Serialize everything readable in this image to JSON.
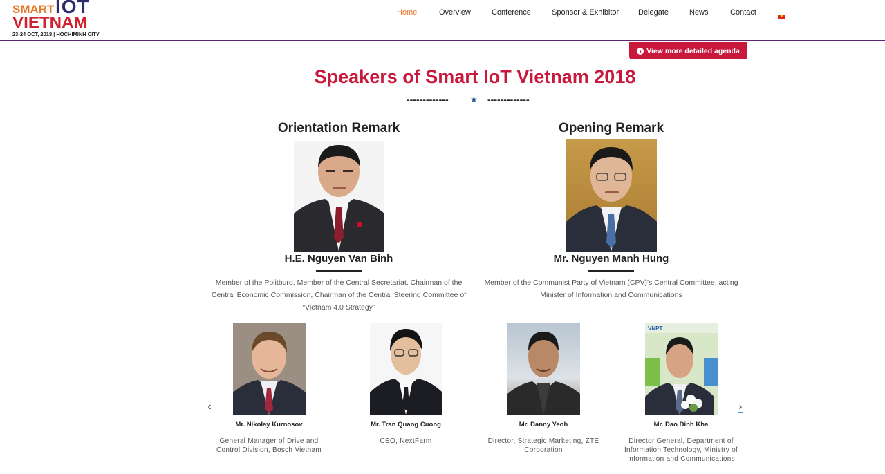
{
  "logo": {
    "smart": "SMART",
    "iot": "IOT",
    "vietnam": "VIETNAM",
    "dates": "23-24 OCT, 2018 | HOCHIMINH CITY"
  },
  "nav": {
    "items": [
      {
        "label": "Home",
        "active": true
      },
      {
        "label": "Overview"
      },
      {
        "label": "Conference"
      },
      {
        "label": "Sponsor & Exhibitor"
      },
      {
        "label": "Delegate"
      },
      {
        "label": "News"
      },
      {
        "label": "Contact"
      }
    ],
    "flag_icon": "vietnam-flag-icon"
  },
  "agenda_button": {
    "label": "View more detailed agenda",
    "icon": "circle-arrow-right-icon"
  },
  "page_title": "Speakers of Smart IoT Vietnam 2018",
  "divider": {
    "left": "-------------",
    "right": "-------------"
  },
  "featured": [
    {
      "section": "Orientation Remark",
      "name": "H.E. Nguyen Van Binh",
      "desc": "Member of the Politburo, Member of the Central Secretariat, Chairman of the Central Economic Commission, Chairman of the Central Steering Committee of “Vietnam 4.0 Strategy”"
    },
    {
      "section": "Opening Remark",
      "name": "Mr. Nguyen Manh Hung",
      "desc": "Member of the Communist Party of Vietnam (CPV)'s Central Committee, acting Minister of Information and Communications"
    }
  ],
  "speakers": [
    {
      "name": "Mr. Nikolay Kurnosov",
      "role": "General Manager of Drive and Control Division, Bosch Vietnam"
    },
    {
      "name": "Mr. Tran Quang Cuong",
      "role": "CEO, NextFarm"
    },
    {
      "name": "Mr. Danny Yeoh",
      "role": "Director, Strategic Marketing, ZTE Corporation"
    },
    {
      "name": "Mr. Dao Dinh Kha",
      "role": "Director General, Department of Information Technology, Ministry of Information and Communications"
    }
  ],
  "photo_backdrop": {
    "sign_text": "VNPT"
  },
  "carousel": {
    "prev": "‹",
    "next": "›"
  },
  "colors": {
    "accent": "#c8193c",
    "nav_active": "#e8782a",
    "header_border": "#5b2a6e"
  }
}
